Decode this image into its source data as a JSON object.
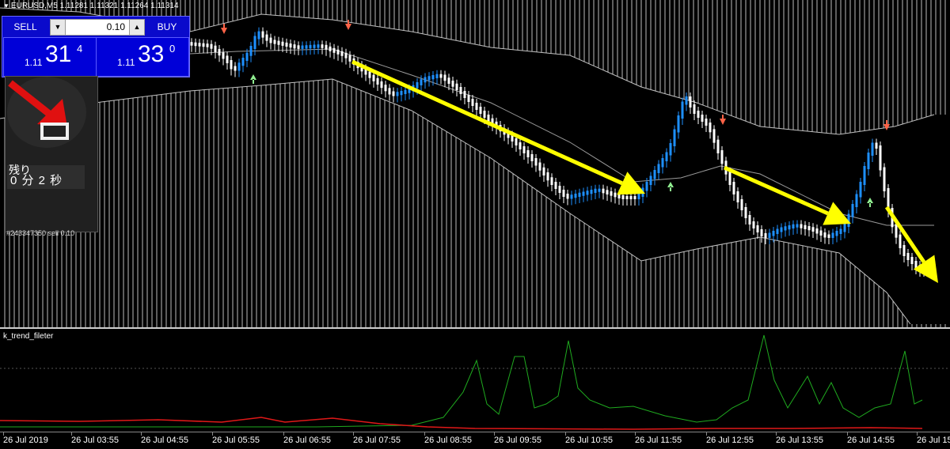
{
  "window": {
    "symbol_line": "EURUSD,M5  1.11281 1.11321 1.11264 1.11314"
  },
  "one_click": {
    "sell_label": "SELL",
    "buy_label": "BUY",
    "lot_value": "0.10",
    "lot_down_icon": "triangle-down",
    "lot_up_icon": "triangle-up",
    "sell_price": {
      "prefix": "1.11",
      "big": "31",
      "sup": "4"
    },
    "buy_price": {
      "prefix": "1.11",
      "big": "33",
      "sup": "0"
    }
  },
  "timer": {
    "label": "残り",
    "value": "0 分 2 秒",
    "arrow_icon": "red-arrow-down-right",
    "indicator_icon": "trend-box-icon"
  },
  "order_line": "#243347350 sell 0.10",
  "subwindow": {
    "title": "k_trend_fileter"
  },
  "x_axis": {
    "labels": [
      "26 Jul 2019",
      "26 Jul 03:55",
      "26 Jul 04:55",
      "26 Jul 05:55",
      "26 Jul 06:55",
      "26 Jul 07:55",
      "26 Jul 08:55",
      "26 Jul 09:55",
      "26 Jul 10:55",
      "26 Jul 11:55",
      "26 Jul 12:55",
      "26 Jul 13:55",
      "26 Jul 14:55",
      "26 Jul 15"
    ]
  },
  "colors": {
    "background": "#000000",
    "bull_candle": "#1e90ff",
    "bear_candle": "#ffffff",
    "band_line": "#c0c0c0",
    "up_signal": "#90ee90",
    "down_signal": "#ff6347",
    "annotation_arrow": "#ffff00",
    "sub_green": "#1faa1f",
    "sub_red": "#e01818",
    "oneclick_blue": "#0000d8"
  }
}
